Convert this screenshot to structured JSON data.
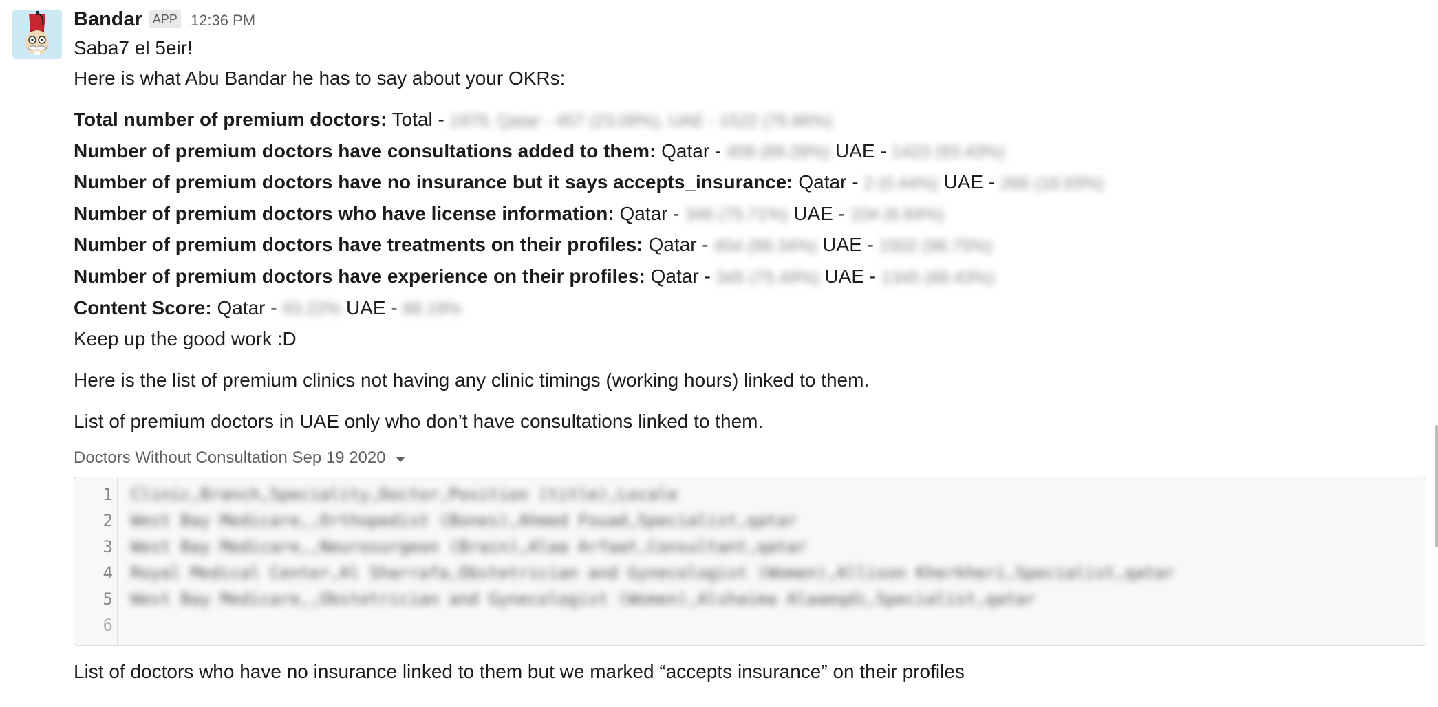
{
  "message": {
    "sender": "Bandar",
    "badge": "APP",
    "time": "12:36 PM"
  },
  "body": {
    "greeting": "Saba7 el 5eir!",
    "intro": "Here is what Abu Bandar he has to say about your OKRs:",
    "stats": [
      {
        "label": "Total number of premium doctors:",
        "parts": [
          "Total - ",
          "1979, Qatar - 457 (23.09%), UAE - 1522 (76.86%)"
        ]
      },
      {
        "label": "Number of premium doctors have consultations added to them:",
        "parts": [
          "Qatar - ",
          "408 (89.28%)",
          "UAE - ",
          "1423 (93.43%)"
        ]
      },
      {
        "label": "Number of premium doctors have no insurance but it says accepts_insurance:",
        "parts": [
          "Qatar - ",
          "2 (0.44%)",
          "UAE - ",
          "266 (18.93%)"
        ]
      },
      {
        "label": "Number of premium doctors who have license information:",
        "parts": [
          "Qatar - ",
          "346 (75.71%)",
          "UAE - ",
          "104 (6.84%)"
        ]
      },
      {
        "label": "Number of premium doctors have treatments on their profiles:",
        "parts": [
          "Qatar - ",
          "454 (99.34%)",
          "UAE - ",
          "1502 (98.75%)"
        ]
      },
      {
        "label": "Number of premium doctors have experience on their profiles:",
        "parts": [
          "Qatar - ",
          "345 (75.49%)",
          "UAE - ",
          "1345 (88.43%)"
        ]
      },
      {
        "label": "Content Score:",
        "parts": [
          "Qatar - ",
          "93.22%",
          "UAE - ",
          "88.19%"
        ]
      }
    ],
    "closing": "Keep up the good work :D",
    "clinics_note": "Here is the list of premium clinics not having any clinic timings (working hours) linked to them.",
    "doctors_note": "List of premium doctors in UAE only who don’t have consultations linked to them.",
    "insurance_note": "List of doctors who have no insurance linked to them but we marked “accepts insurance” on their profiles"
  },
  "snippet": {
    "title": "Doctors Without Consultation Sep 19 2020",
    "lines": [
      {
        "n": "1",
        "text": "Clinic,Branch,Speciality,Doctor,Position (title),Locale"
      },
      {
        "n": "2",
        "text": "West Bay Medicare,,Orthopedist (Bones),Ahmed Fouad,Specialist,qatar"
      },
      {
        "n": "3",
        "text": "West Bay Medicare,,Neurosurgeon (Brain),Alaa Arfaat,Consultant,qatar"
      },
      {
        "n": "4",
        "text": "Royal Medical Center,Al Sharrafa,Obstetrician and Gynecologist (Women),Allison Kherkheri,Specialist,qatar"
      },
      {
        "n": "5",
        "text": "West Bay Medicare,,Obstetrician and Gynecologist (Women),Alshaima Alaaeqdi,Specialist,qatar"
      },
      {
        "n": "6",
        "text": ""
      }
    ]
  },
  "colors": {
    "text": "#1d1c1d",
    "muted": "#616061",
    "avatar_bg": "#cde9f6",
    "fez_red": "#c8262e"
  }
}
